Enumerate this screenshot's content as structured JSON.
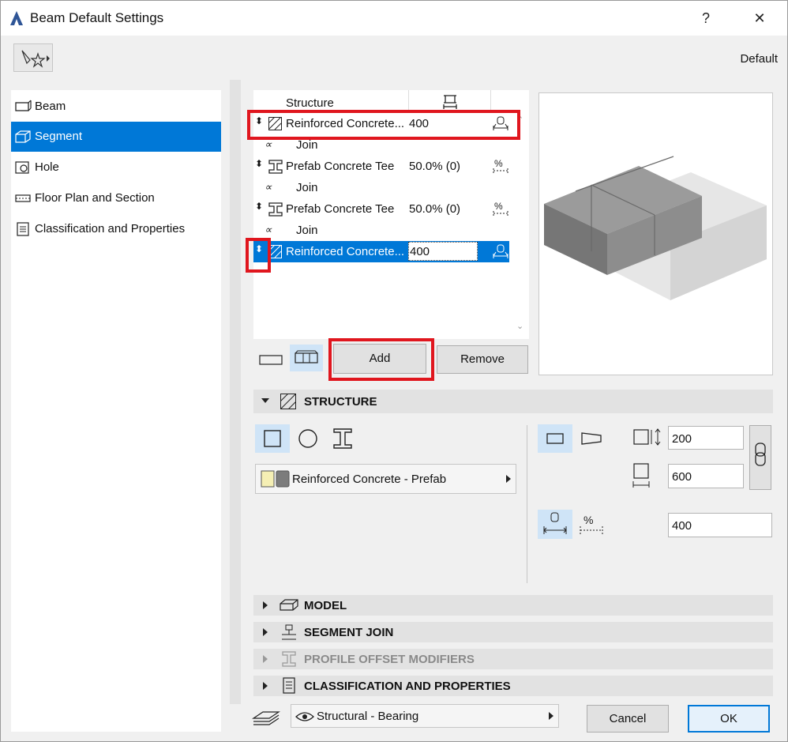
{
  "window": {
    "title": "Beam Default Settings",
    "help_label": "?",
    "close_label": "✕"
  },
  "header": {
    "default_label": "Default"
  },
  "nav": {
    "items": [
      {
        "label": "Beam"
      },
      {
        "label": "Segment"
      },
      {
        "label": "Hole"
      },
      {
        "label": "Floor Plan and Section"
      },
      {
        "label": "Classification and Properties"
      }
    ]
  },
  "structure_list": {
    "header": "Structure",
    "rows": [
      {
        "kind": "segment",
        "label": "Reinforced Concrete...",
        "value": "400"
      },
      {
        "kind": "join",
        "label": "Join"
      },
      {
        "kind": "segment",
        "label": "Prefab Concrete Tee",
        "value": "50.0% (0)"
      },
      {
        "kind": "join",
        "label": "Join"
      },
      {
        "kind": "segment",
        "label": "Prefab Concrete Tee",
        "value": "50.0% (0)"
      },
      {
        "kind": "join",
        "label": "Join"
      },
      {
        "kind": "segment",
        "label": "Reinforced Concrete...",
        "value": "400"
      }
    ],
    "add_label": "Add",
    "remove_label": "Remove",
    "highlight_color": "#e0161e"
  },
  "sections": {
    "structure": "STRUCTURE",
    "model": "MODEL",
    "segment_join": "SEGMENT JOIN",
    "profile_offset": "PROFILE OFFSET MODIFIERS",
    "classification": "CLASSIFICATION AND PROPERTIES"
  },
  "structure_panel": {
    "material": "Reinforced Concrete - Prefab",
    "width": "200",
    "height": "600",
    "length": "400"
  },
  "footer": {
    "layer": "Structural - Bearing",
    "cancel_label": "Cancel",
    "ok_label": "OK"
  },
  "colors": {
    "accent": "#0078d7",
    "panel": "#f0f0f0",
    "section": "#e2e2e2"
  }
}
